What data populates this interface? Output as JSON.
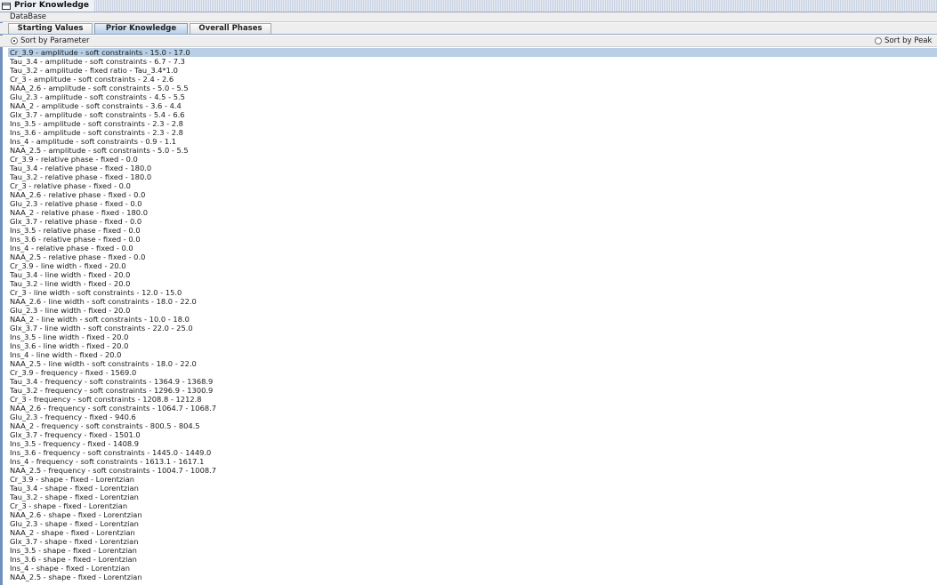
{
  "window": {
    "title": "Prior Knowledge"
  },
  "section_label": "DataBase",
  "tabs": [
    {
      "label": "Starting Values",
      "active": false
    },
    {
      "label": "Prior Knowledge",
      "active": true
    },
    {
      "label": "Overall Phases",
      "active": false
    }
  ],
  "sort": {
    "by_parameter": "Sort by Parameter",
    "by_peak": "Sort by Peak",
    "selected": "parameter"
  },
  "selected_index": 0,
  "items": [
    "Cr_3.9 - amplitude - soft constraints - 15.0 - 17.0",
    "Tau_3.4 - amplitude - soft constraints - 6.7 - 7.3",
    "Tau_3.2 - amplitude - fixed ratio - Tau_3.4*1.0",
    "Cr_3 - amplitude - soft constraints - 2.4 - 2.6",
    "NAA_2.6 - amplitude - soft constraints - 5.0 - 5.5",
    "Glu_2.3 - amplitude - soft constraints - 4.5 - 5.5",
    "NAA_2 - amplitude - soft constraints - 3.6 - 4.4",
    "Glx_3.7 - amplitude - soft constraints - 5.4 - 6.6",
    "Ins_3.5 - amplitude - soft constraints - 2.3 - 2.8",
    "Ins_3.6 - amplitude - soft constraints - 2.3 - 2.8",
    "Ins_4 - amplitude - soft constraints - 0.9 - 1.1",
    "NAA_2.5 - amplitude - soft constraints - 5.0 - 5.5",
    "Cr_3.9 - relative phase - fixed - 0.0",
    "Tau_3.4 - relative phase - fixed - 180.0",
    "Tau_3.2 - relative phase - fixed - 180.0",
    "Cr_3 - relative phase - fixed - 0.0",
    "NAA_2.6 - relative phase - fixed - 0.0",
    "Glu_2.3 - relative phase - fixed - 0.0",
    "NAA_2 - relative phase - fixed - 180.0",
    "Glx_3.7 - relative phase - fixed - 0.0",
    "Ins_3.5 - relative phase - fixed - 0.0",
    "Ins_3.6 - relative phase - fixed - 0.0",
    "Ins_4 - relative phase - fixed - 0.0",
    "NAA_2.5 - relative phase - fixed - 0.0",
    "Cr_3.9 - line width - fixed - 20.0",
    "Tau_3.4 - line width - fixed - 20.0",
    "Tau_3.2 - line width - fixed - 20.0",
    "Cr_3 - line width - soft constraints - 12.0 - 15.0",
    "NAA_2.6 - line width - soft constraints - 18.0 - 22.0",
    "Glu_2.3 - line width - fixed - 20.0",
    "NAA_2 - line width - soft constraints - 10.0 - 18.0",
    "Glx_3.7 - line width - soft constraints - 22.0 - 25.0",
    "Ins_3.5 - line width - fixed - 20.0",
    "Ins_3.6 - line width - fixed - 20.0",
    "Ins_4 - line width - fixed - 20.0",
    "NAA_2.5 - line width - soft constraints - 18.0 - 22.0",
    "Cr_3.9 - frequency - fixed - 1569.0",
    "Tau_3.4 - frequency - soft constraints - 1364.9 - 1368.9",
    "Tau_3.2 - frequency - soft constraints - 1296.9 - 1300.9",
    "Cr_3 - frequency - soft constraints - 1208.8 - 1212.8",
    "NAA_2.6 - frequency - soft constraints - 1064.7 - 1068.7",
    "Glu_2.3 - frequency - fixed - 940.6",
    "NAA_2 - frequency - soft constraints - 800.5 - 804.5",
    "Glx_3.7 - frequency - fixed - 1501.0",
    "Ins_3.5 - frequency - fixed - 1408.9",
    "Ins_3.6 - frequency - soft constraints - 1445.0 - 1449.0",
    "Ins_4 - frequency - soft constraints - 1613.1 - 1617.1",
    "NAA_2.5 - frequency - soft constraints - 1004.7 - 1008.7",
    "Cr_3.9 - shape - fixed - Lorentzian",
    "Tau_3.4 - shape - fixed - Lorentzian",
    "Tau_3.2 - shape - fixed - Lorentzian",
    "Cr_3 - shape - fixed - Lorentzian",
    "NAA_2.6 - shape - fixed - Lorentzian",
    "Glu_2.3 - shape - fixed - Lorentzian",
    "NAA_2 - shape - fixed - Lorentzian",
    "Glx_3.7 - shape - fixed - Lorentzian",
    "Ins_3.5 - shape - fixed - Lorentzian",
    "Ins_3.6 - shape - fixed - Lorentzian",
    "Ins_4 - shape - fixed - Lorentzian",
    "NAA_2.5 - shape - fixed - Lorentzian"
  ]
}
